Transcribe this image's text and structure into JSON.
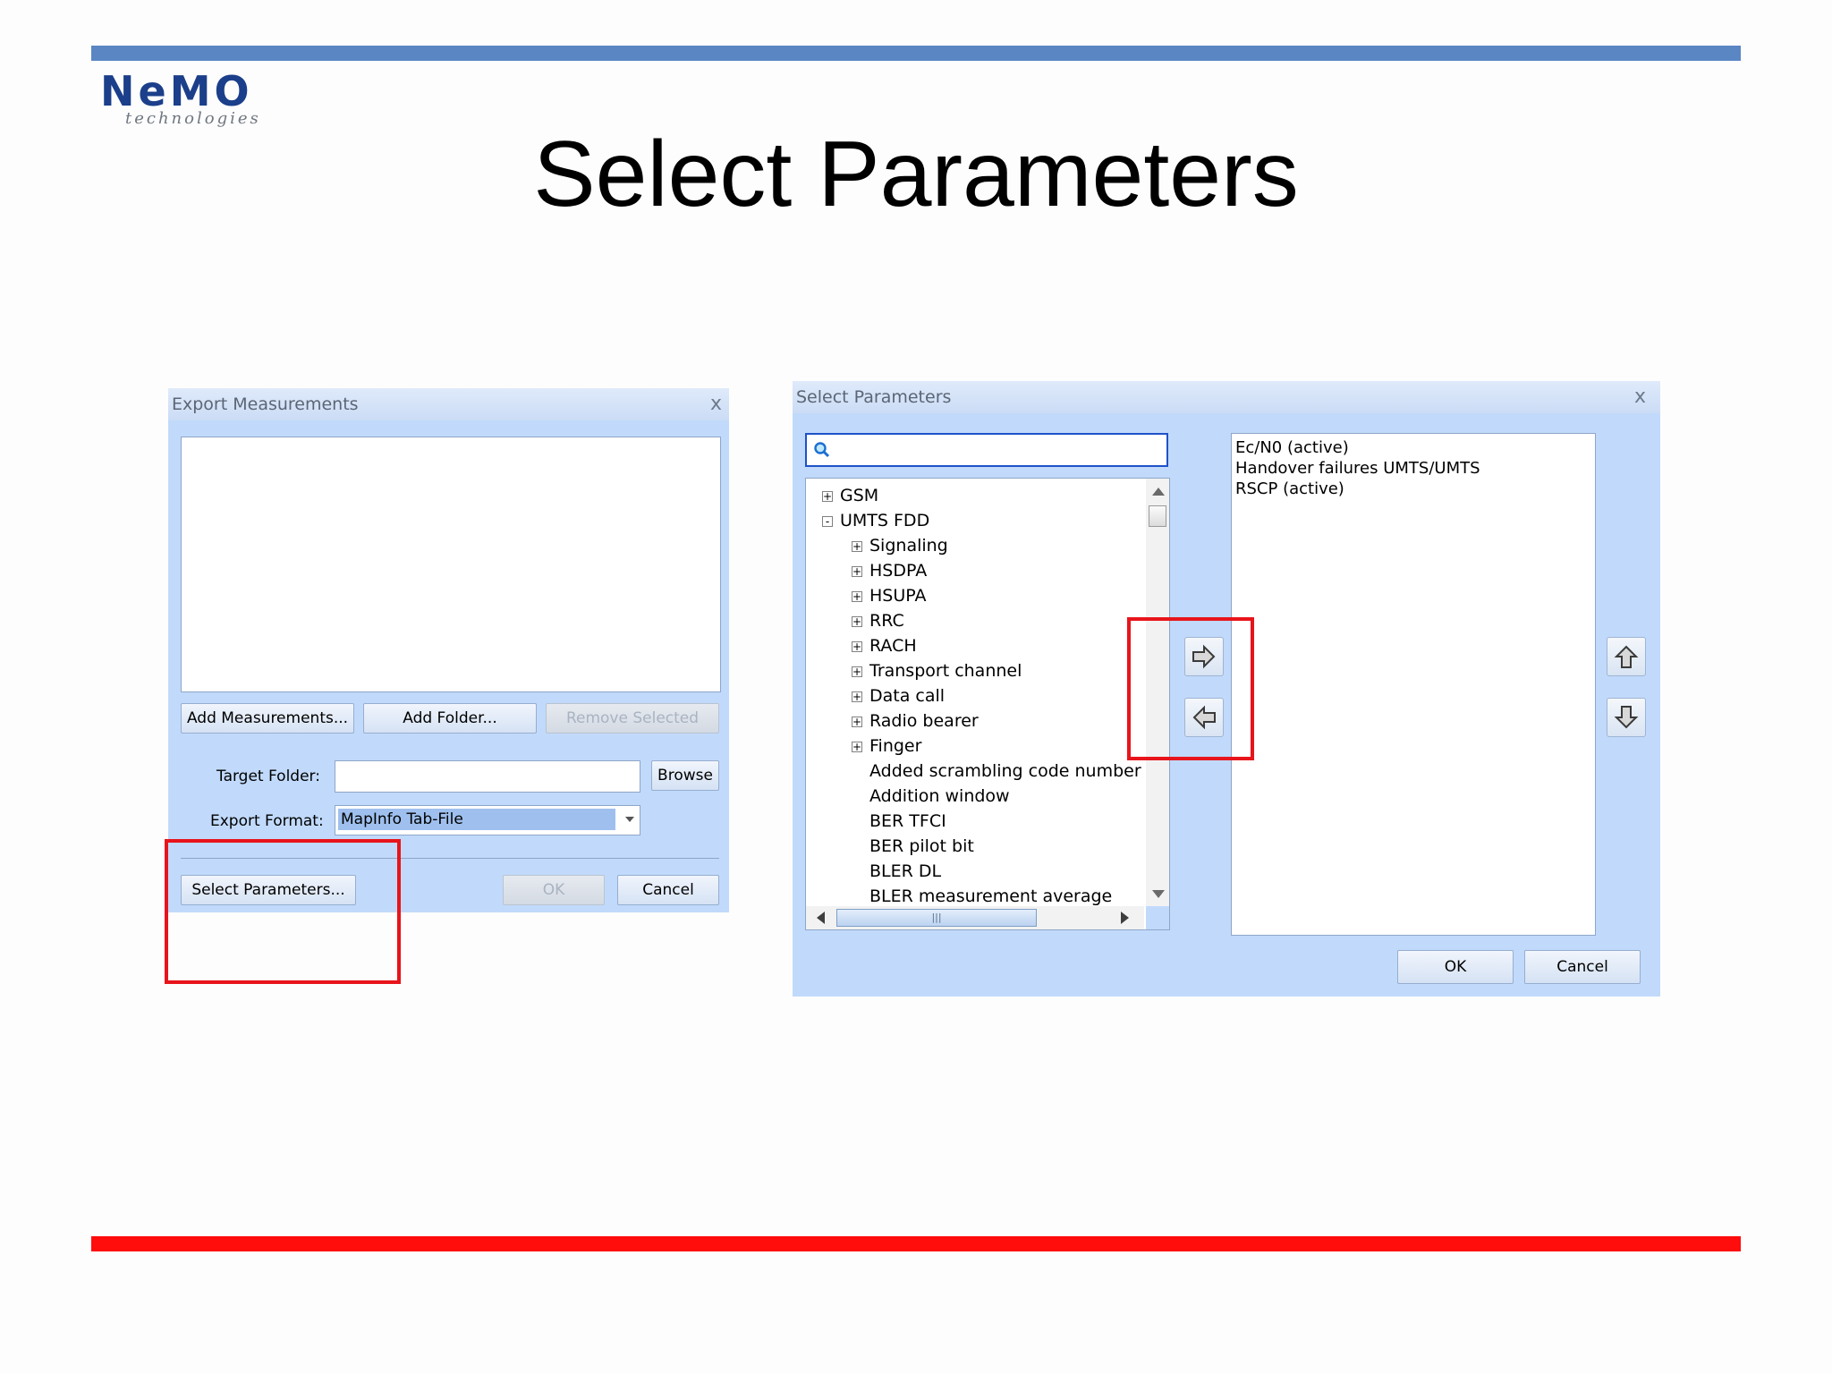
{
  "slide": {
    "title": "Select Parameters",
    "logo": {
      "word": "NeMO",
      "sub": "technologies"
    }
  },
  "export_dialog": {
    "title": "Export Measurements",
    "close": "x",
    "buttons": {
      "add_measurements": "Add Measurements...",
      "add_folder": "Add Folder...",
      "remove_selected": "Remove Selected",
      "browse": "Browse",
      "select_parameters": "Select Parameters...",
      "ok": "OK",
      "cancel": "Cancel"
    },
    "target_folder_label": "Target Folder:",
    "target_folder_value": "",
    "export_format_label": "Export Format:",
    "export_format_value": "MapInfo Tab-File"
  },
  "select_dialog": {
    "title": "Select Parameters",
    "close": "x",
    "search_value": "",
    "tree": [
      {
        "label": "GSM",
        "level": 0,
        "toggle": "+"
      },
      {
        "label": "UMTS FDD",
        "level": 0,
        "toggle": "-"
      },
      {
        "label": "Signaling",
        "level": 1,
        "toggle": "+"
      },
      {
        "label": "HSDPA",
        "level": 1,
        "toggle": "+"
      },
      {
        "label": "HSUPA",
        "level": 1,
        "toggle": "+"
      },
      {
        "label": "RRC",
        "level": 1,
        "toggle": "+"
      },
      {
        "label": "RACH",
        "level": 1,
        "toggle": "+"
      },
      {
        "label": "Transport channel",
        "level": 1,
        "toggle": "+"
      },
      {
        "label": "Data call",
        "level": 1,
        "toggle": "+"
      },
      {
        "label": "Radio bearer",
        "level": 1,
        "toggle": "+"
      },
      {
        "label": "Finger",
        "level": 1,
        "toggle": "+"
      },
      {
        "label": "Added scrambling code number",
        "level": 1,
        "toggle": ""
      },
      {
        "label": "Addition window",
        "level": 1,
        "toggle": ""
      },
      {
        "label": "BER TFCI",
        "level": 1,
        "toggle": ""
      },
      {
        "label": "BER pilot bit",
        "level": 1,
        "toggle": ""
      },
      {
        "label": "BLER DL",
        "level": 1,
        "toggle": ""
      },
      {
        "label": "BLER measurement average",
        "level": 1,
        "toggle": ""
      }
    ],
    "selected": [
      "Ec/N0 (active)",
      "Handover failures UMTS/UMTS",
      "RSCP (active)"
    ],
    "buttons": {
      "ok": "OK",
      "cancel": "Cancel"
    },
    "scroll_grip": "|||"
  },
  "icons": {
    "search": "search-icon",
    "move_right": "arrow-right-icon",
    "move_left": "arrow-left-icon",
    "move_up": "arrow-up-icon",
    "move_down": "arrow-down-icon"
  },
  "colors": {
    "top_bar": "#5a86c4",
    "bottom_bar": "#ff0d0d",
    "highlight": "#e8141b",
    "dialog_bg": "#c1dafb",
    "logo": "#1b3f8a"
  }
}
